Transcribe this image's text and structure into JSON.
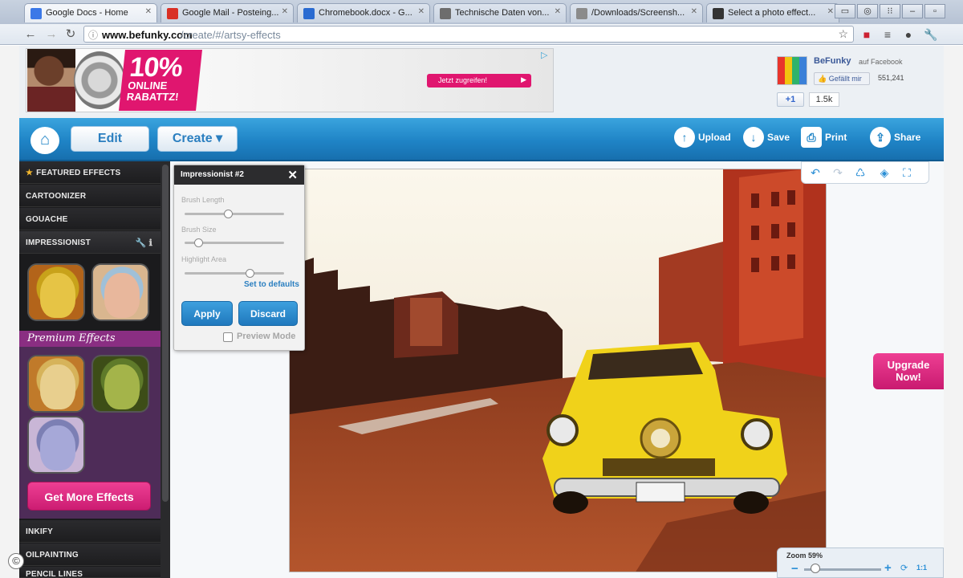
{
  "browser": {
    "tabs": [
      {
        "label": "Google Docs - Home",
        "favicon_color": "#3b78e7"
      },
      {
        "label": "Google Mail - Posteing...",
        "favicon_color": "#d93025"
      },
      {
        "label": "Chromebook.docx - G...",
        "favicon_color": "#2a6bd1"
      },
      {
        "label": "Technische Daten von...",
        "favicon_color": "#6d6d6d"
      },
      {
        "label": "/Downloads/Screensh...",
        "favicon_color": "#8b8b8b"
      },
      {
        "label": "Select a photo effect...",
        "favicon_color": "#333333"
      }
    ],
    "url_host": "www.befunky.com",
    "url_path": "/create/#/artsy-effects"
  },
  "ad": {
    "percent": "10%",
    "line1": "ONLINE",
    "line2": "RABATTZ!",
    "cta": "Jetzt zugreifen!"
  },
  "social": {
    "fb_name": "BeFunky",
    "fb_sub": "auf Facebook",
    "fb_like": "Gefällt mir",
    "fb_count": "551,241",
    "gplus": "+1",
    "gplus_count": "1.5k"
  },
  "appnav": {
    "edit": "Edit",
    "create": "Create ▾",
    "upload": "Upload",
    "save": "Save",
    "print": "Print",
    "share": "Share"
  },
  "sidebar": {
    "featured": "FEATURED EFFECTS",
    "cartoonizer": "CARTOONIZER",
    "gouache": "GOUACHE",
    "impressionist": "IMPRESSIONIST",
    "premium": "Premium Effects",
    "get_more": "Get More Effects",
    "inkify": "INKIFY",
    "oilpainting": "OILPAINTING",
    "last": "PENCIL LINES"
  },
  "panel": {
    "title": "Impressionist #2",
    "slider1_label": "Brush Length",
    "slider1_value": 0.44,
    "slider2_label": "Brush Size",
    "slider2_value": 0.14,
    "slider3_label": "Highlight Area",
    "slider3_value": 0.66,
    "reset": "Set to defaults",
    "apply": "Apply",
    "discard": "Discard",
    "preview": "Preview Mode"
  },
  "canvas": {
    "upgrade_line1": "Upgrade",
    "upgrade_line2": "Now!",
    "zoom_label": "Zoom 59%",
    "zoom_value": 0.59,
    "zoom_11": "1:1"
  },
  "colors": {
    "brand_blue": "#1f84c6",
    "accent_pink": "#e0166f",
    "premium_purple": "#8a2e82"
  },
  "copyright": "©"
}
